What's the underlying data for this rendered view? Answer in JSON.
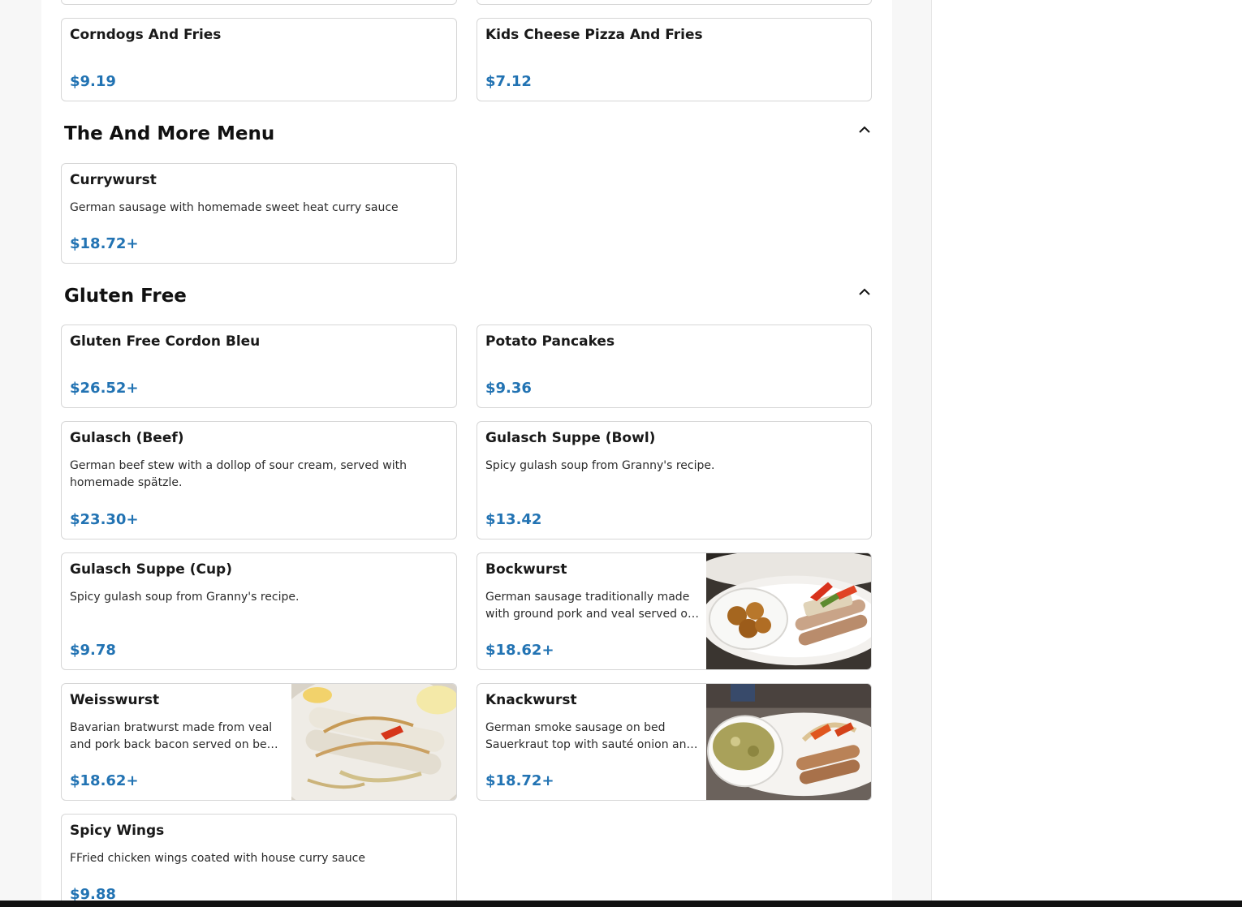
{
  "sections": [
    {
      "title": "The And More Menu",
      "collapse_icon": "chevron-up-icon"
    },
    {
      "title": "Gluten Free",
      "collapse_icon": "chevron-up-icon"
    }
  ],
  "items": {
    "corndogs": {
      "name": "Corndogs And Fries",
      "price": "$9.19"
    },
    "kids_pizza": {
      "name": "Kids Cheese Pizza And Fries",
      "price": "$7.12"
    },
    "currywurst": {
      "name": "Currywurst",
      "description": "German sausage with homemade sweet heat curry sauce",
      "price": "$18.72+"
    },
    "gf_cordon_bleu": {
      "name": "Gluten Free Cordon Bleu",
      "price": "$26.52+"
    },
    "potato_pancakes": {
      "name": "Potato Pancakes",
      "price": "$9.36"
    },
    "gulasch_beef": {
      "name": "Gulasch (Beef)",
      "description": "German beef stew with a dollop of sour cream, served with homemade spätzle.",
      "price": "$23.30+"
    },
    "gulasch_bowl": {
      "name": "Gulasch Suppe (Bowl)",
      "description": "Spicy gulash soup from Granny's recipe.",
      "price": "$13.42"
    },
    "gulasch_cup": {
      "name": "Gulasch Suppe (Cup)",
      "description": "Spicy gulash soup from Granny's recipe.",
      "price": "$9.78"
    },
    "bockwurst": {
      "name": "Bockwurst",
      "description": "German sausage traditionally made with ground pork and veal served on bed of sauerkraut",
      "price": "$18.62+"
    },
    "weisswurst": {
      "name": "Weisswurst",
      "description": "Bavarian bratwurst made from veal and pork back bacon served on bed of sauerkraut",
      "price": "$18.62+"
    },
    "knackwurst": {
      "name": "Knackwurst",
      "description": "German smoke sausage on bed Sauerkraut top with sauté onion and peppers",
      "price": "$18.72+"
    },
    "spicy_wings": {
      "name": "Spicy Wings",
      "description": "FFried chicken wings coated with house curry sauce",
      "price": "$9.88"
    }
  },
  "colors": {
    "price": "#2273b3",
    "border": "#d6d6d6",
    "page_bg": "#f7f7f7"
  }
}
